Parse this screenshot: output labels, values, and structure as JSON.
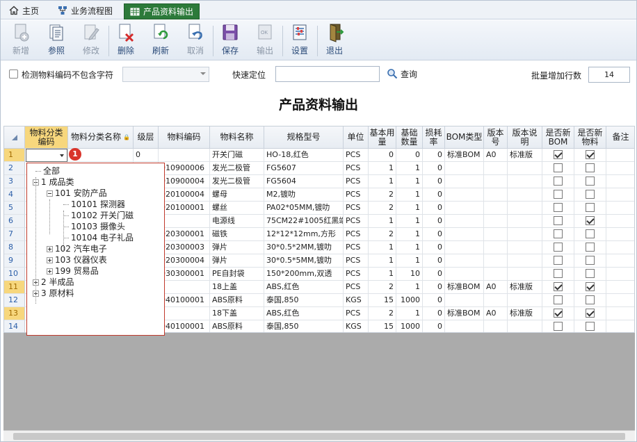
{
  "tabs": [
    {
      "label": "主页",
      "icon": "home-icon"
    },
    {
      "label": "业务流程图",
      "icon": "flowchart-icon"
    },
    {
      "label": "产品资料输出",
      "icon": "table-icon",
      "active": true
    }
  ],
  "toolbar": [
    {
      "label": "新增",
      "icon": "new-doc-icon",
      "disabled": true
    },
    {
      "label": "参照",
      "icon": "reference-icon",
      "disabled": false
    },
    {
      "label": "修改",
      "icon": "edit-icon",
      "disabled": true
    },
    {
      "label": "删除",
      "icon": "delete-icon",
      "disabled": false
    },
    {
      "label": "刷新",
      "icon": "refresh-icon",
      "disabled": false
    },
    {
      "label": "取消",
      "icon": "undo-icon",
      "disabled": true
    },
    {
      "label": "保存",
      "icon": "save-icon",
      "disabled": false
    },
    {
      "label": "输出",
      "icon": "export-icon",
      "disabled": true
    },
    {
      "label": "设置",
      "icon": "settings-icon",
      "disabled": false
    },
    {
      "label": "退出",
      "icon": "exit-icon",
      "disabled": false
    }
  ],
  "filter": {
    "exclude_label": "检测物料编码不包含字符",
    "locate_label": "快速定位",
    "query_label": "查询",
    "batch_label": "批量增加行数",
    "batch_value": "14",
    "locate_value": ""
  },
  "page_title": "产品资料输出",
  "columns": [
    "物料分类编码",
    "物料分类名称",
    "级层",
    "物料编码",
    "物料名称",
    "规格型号",
    "单位",
    "基本用量",
    "基础数量",
    "损耗率",
    "BOM类型",
    "版本号",
    "版本说明",
    "是否新BOM",
    "是否新物料",
    "备注"
  ],
  "rows": [
    {
      "n": "1",
      "lvl": "0",
      "code": "",
      "name": "开关门磁",
      "spec": "HO-18,红色",
      "unit": "PCS",
      "base": "0",
      "qty": "0",
      "loss": "0",
      "bom": "标准BOM",
      "ver": "A0",
      "vdesc": "标准版",
      "newbom": true,
      "newmat": true
    },
    {
      "n": "2",
      "lvl": "",
      "code": "010900006",
      "name": "发光二极管",
      "spec": "FG5607",
      "unit": "PCS",
      "base": "1",
      "qty": "1",
      "loss": "0",
      "bom": "",
      "ver": "",
      "vdesc": "",
      "newbom": false,
      "newmat": false
    },
    {
      "n": "3",
      "lvl": "",
      "code": "010900004",
      "name": "发光二极管",
      "spec": "FG5604",
      "unit": "PCS",
      "base": "1",
      "qty": "1",
      "loss": "0",
      "bom": "",
      "ver": "",
      "vdesc": "",
      "newbom": false,
      "newmat": false
    },
    {
      "n": "4",
      "lvl": "",
      "code": "020100004",
      "name": "螺母",
      "spec": "M2,镀叻",
      "unit": "PCS",
      "base": "2",
      "qty": "1",
      "loss": "0",
      "bom": "",
      "ver": "",
      "vdesc": "",
      "newbom": false,
      "newmat": false
    },
    {
      "n": "5",
      "lvl": "",
      "code": "020100001",
      "name": "螺丝",
      "spec": "PA02*05MM,镀叻",
      "unit": "PCS",
      "base": "2",
      "qty": "1",
      "loss": "0",
      "bom": "",
      "ver": "",
      "vdesc": "",
      "newbom": false,
      "newmat": false
    },
    {
      "n": "6",
      "lvl": "",
      "code": "",
      "name": "电源线",
      "spec": "75CM22#1005红黑端",
      "unit": "PCS",
      "base": "1",
      "qty": "1",
      "loss": "0",
      "bom": "",
      "ver": "",
      "vdesc": "",
      "newbom": false,
      "newmat": true
    },
    {
      "n": "7",
      "lvl": "",
      "code": "020300001",
      "name": "磁铁",
      "spec": "12*12*12mm,方形",
      "unit": "PCS",
      "base": "2",
      "qty": "1",
      "loss": "0",
      "bom": "",
      "ver": "",
      "vdesc": "",
      "newbom": false,
      "newmat": false
    },
    {
      "n": "8",
      "lvl": "",
      "code": "020300003",
      "name": "弹片",
      "spec": "30*0.5*2MM,镀叻",
      "unit": "PCS",
      "base": "1",
      "qty": "1",
      "loss": "0",
      "bom": "",
      "ver": "",
      "vdesc": "",
      "newbom": false,
      "newmat": false
    },
    {
      "n": "9",
      "lvl": "",
      "code": "020300004",
      "name": "弹片",
      "spec": "30*0.5*5MM,镀叻",
      "unit": "PCS",
      "base": "1",
      "qty": "1",
      "loss": "0",
      "bom": "",
      "ver": "",
      "vdesc": "",
      "newbom": false,
      "newmat": false
    },
    {
      "n": "10",
      "lvl": "",
      "code": "030300001",
      "name": "PE自封袋",
      "spec": "150*200mm,双透",
      "unit": "PCS",
      "base": "1",
      "qty": "10",
      "loss": "0",
      "bom": "",
      "ver": "",
      "vdesc": "",
      "newbom": false,
      "newmat": false
    },
    {
      "n": "11",
      "lvl": "",
      "code": "",
      "name": "18上盖",
      "spec": "ABS,红色",
      "unit": "PCS",
      "base": "2",
      "qty": "1",
      "loss": "0",
      "bom": "标准BOM",
      "ver": "A0",
      "vdesc": "标准版",
      "newbom": true,
      "newmat": true
    },
    {
      "n": "12",
      "lvl": "",
      "code": "040100001",
      "name": "ABS原料",
      "spec": "泰国,850",
      "unit": "KGS",
      "base": "15",
      "qty": "1000",
      "loss": "0",
      "bom": "",
      "ver": "",
      "vdesc": "",
      "newbom": false,
      "newmat": false
    },
    {
      "n": "13",
      "lvl": "",
      "code": "",
      "name": "18下盖",
      "spec": "ABS,红色",
      "unit": "PCS",
      "base": "2",
      "qty": "1",
      "loss": "0",
      "bom": "标准BOM",
      "ver": "A0",
      "vdesc": "标准版",
      "newbom": true,
      "newmat": true
    },
    {
      "n": "14",
      "lvl": "",
      "code": "040100001",
      "name": "ABS原料",
      "spec": "泰国,850",
      "unit": "KGS",
      "base": "15",
      "qty": "1000",
      "loss": "0",
      "bom": "",
      "ver": "",
      "vdesc": "",
      "newbom": false,
      "newmat": false
    }
  ],
  "tree": [
    {
      "label": "全部",
      "depth": 0,
      "toggle": "none"
    },
    {
      "label": "1 成品类",
      "depth": 0,
      "toggle": "minus"
    },
    {
      "label": "101 安防产品",
      "depth": 1,
      "toggle": "minus"
    },
    {
      "label": "10101 探测器",
      "depth": 2,
      "toggle": "none"
    },
    {
      "label": "10102 开关门磁",
      "depth": 2,
      "toggle": "none"
    },
    {
      "label": "10103 摄像头",
      "depth": 2,
      "toggle": "none"
    },
    {
      "label": "10104 电子礼品",
      "depth": 2,
      "toggle": "none"
    },
    {
      "label": "102 汽车电子",
      "depth": 1,
      "toggle": "plus"
    },
    {
      "label": "103 仪器仪表",
      "depth": 1,
      "toggle": "plus"
    },
    {
      "label": "199 贸易品",
      "depth": 1,
      "toggle": "plus"
    },
    {
      "label": "2 半成品",
      "depth": 0,
      "toggle": "plus"
    },
    {
      "label": "3 原材料",
      "depth": 0,
      "toggle": "plus"
    }
  ],
  "badge": "1",
  "colors": {
    "active_tab": "#2c7a3a",
    "selected_header": "#f7d77d",
    "dropdown_border": "#c0392b",
    "badge": "#d9342b"
  }
}
